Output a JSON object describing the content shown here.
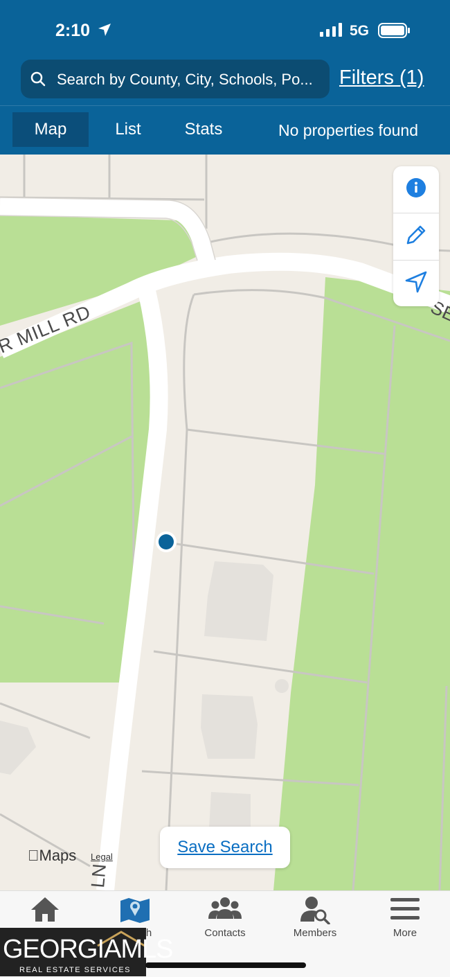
{
  "status_bar": {
    "time": "2:10",
    "network": "5G"
  },
  "header": {
    "search_placeholder": "Search by County, City, Schools, Po...",
    "filters_label": "Filters (1)",
    "tabs": [
      {
        "label": "Map",
        "active": true
      },
      {
        "label": "List",
        "active": false
      },
      {
        "label": "Stats",
        "active": false
      }
    ],
    "result_text": "No properties found"
  },
  "map": {
    "road_labels": [
      "R MILL RD",
      "SE",
      "LN"
    ],
    "controls": [
      "info-icon",
      "pencil-icon",
      "navigation-arrow-icon"
    ],
    "save_search_label": "Save Search",
    "attribution": "Maps",
    "legal_label": "Legal"
  },
  "bottom_nav": {
    "items": [
      {
        "label": "",
        "icon": "home-icon"
      },
      {
        "label": "h",
        "icon": "map-search-icon",
        "active": true
      },
      {
        "label": "Contacts",
        "icon": "contacts-icon"
      },
      {
        "label": "Members",
        "icon": "members-search-icon"
      },
      {
        "label": "More",
        "icon": "menu-icon"
      }
    ]
  },
  "logo": {
    "text_main": "GEORGIAMLS",
    "text_sub": "REAL ESTATE SERVICES"
  },
  "colors": {
    "header": "#0a6399",
    "accent": "#0a6ec2",
    "grass": "#b9df95",
    "land": "#f1ede6"
  }
}
